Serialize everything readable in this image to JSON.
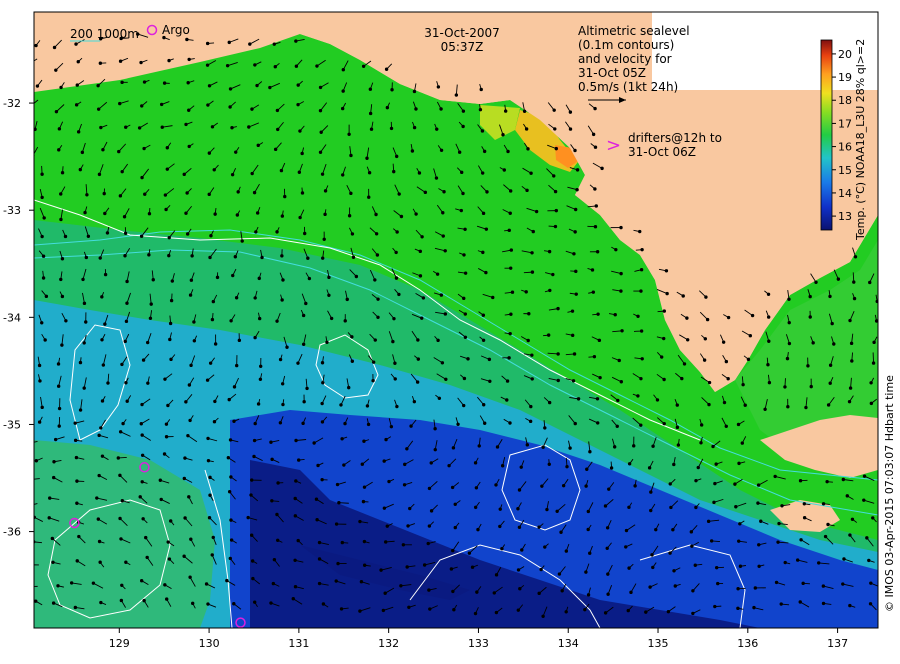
{
  "title": {
    "date": "31-Oct-2007",
    "time": "05:37Z"
  },
  "legend_topleft": {
    "isobath_label": "200  1000m",
    "argo_label": "Argo"
  },
  "annotation_sealevel": {
    "lines": [
      "Altimetric sealevel",
      "(0.1m contours)",
      "and velocity for",
      "31-Oct 05Z",
      "0.5m/s (1kt 24h)"
    ]
  },
  "annotation_drifters": {
    "symbol": ">",
    "lines": [
      "drifters@12h to",
      "31-Oct 06Z"
    ]
  },
  "colorbar": {
    "label": "Temp. (°C) NOAA18_L3U 28% ql>=2",
    "ticks": [
      "13",
      "14",
      "15",
      "16",
      "17",
      "18",
      "19",
      "20"
    ],
    "min": 12.4,
    "max": 20.6
  },
  "credit": "© IMOS 03-Apr-2015 07:03:07 Hdbart time",
  "axes": {
    "x_ticks": [
      "129",
      "130",
      "131",
      "132",
      "133",
      "134",
      "135",
      "136",
      "137"
    ],
    "x_values": [
      129,
      130,
      131,
      132,
      133,
      134,
      135,
      136,
      137
    ],
    "y_ticks": [
      "-32",
      "-33",
      "-34",
      "-35",
      "-36"
    ],
    "y_values": [
      -32,
      -33,
      -34,
      -35,
      -36
    ],
    "x_range": [
      128.05,
      137.45
    ],
    "y_range": [
      -36.9,
      -31.15
    ]
  },
  "colors": {
    "land": "#f9c8a0",
    "warm": "#ffa020",
    "green": "#22cc22",
    "cyan": "#22aadd",
    "blue": "#1144cc",
    "deep_blue": "#0a1a80",
    "argo": "#dd22dd",
    "isobath": "#44dddd"
  },
  "argo_floats": [
    {
      "lon": 129.28,
      "lat": -35.4
    },
    {
      "lon": 128.5,
      "lat": -35.92
    },
    {
      "lon": 130.35,
      "lat": -36.85
    }
  ]
}
